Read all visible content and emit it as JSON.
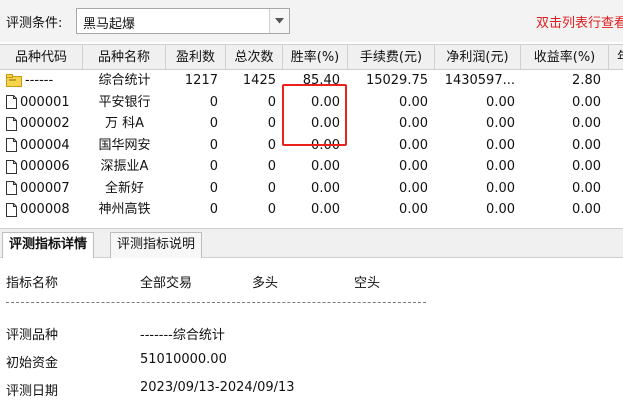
{
  "filter": {
    "label": "评测条件:",
    "value": "黑马起爆",
    "hint": "双击列表行查看"
  },
  "table": {
    "columns": [
      "品种代码",
      "品种名称",
      "盈利数",
      "总次数",
      "胜率(%)",
      "手续费(元)",
      "净利润(元)",
      "收益率(%)",
      "年"
    ],
    "rows": [
      {
        "code": "------",
        "name": "综合统计",
        "win": "1217",
        "total": "1425",
        "rate": "85.40",
        "fee": "15029.75",
        "profit": "1430597...",
        "ret": "2.80",
        "icon": "folder-icon"
      },
      {
        "code": "000001",
        "name": "平安银行",
        "win": "0",
        "total": "0",
        "rate": "0.00",
        "fee": "0.00",
        "profit": "0.00",
        "ret": "0.00",
        "icon": "document-icon"
      },
      {
        "code": "000002",
        "name": "万 科A",
        "win": "0",
        "total": "0",
        "rate": "0.00",
        "fee": "0.00",
        "profit": "0.00",
        "ret": "0.00",
        "icon": "document-icon"
      },
      {
        "code": "000004",
        "name": "国华网安",
        "win": "0",
        "total": "0",
        "rate": "0.00",
        "fee": "0.00",
        "profit": "0.00",
        "ret": "0.00",
        "icon": "document-icon"
      },
      {
        "code": "000006",
        "name": "深振业A",
        "win": "0",
        "total": "0",
        "rate": "0.00",
        "fee": "0.00",
        "profit": "0.00",
        "ret": "0.00",
        "icon": "document-icon"
      },
      {
        "code": "000007",
        "name": "全新好",
        "win": "0",
        "total": "0",
        "rate": "0.00",
        "fee": "0.00",
        "profit": "0.00",
        "ret": "0.00",
        "icon": "document-icon"
      },
      {
        "code": "000008",
        "name": "神州高铁",
        "win": "0",
        "total": "0",
        "rate": "0.00",
        "fee": "0.00",
        "profit": "0.00",
        "ret": "0.00",
        "icon": "document-icon"
      }
    ]
  },
  "tabs": [
    {
      "label": "评测指标详情",
      "active": true
    },
    {
      "label": "评测指标说明",
      "active": false
    }
  ],
  "details": {
    "header": [
      "指标名称",
      "全部交易",
      "多头",
      "空头"
    ],
    "separator": "--------------------------------------------------------------------------",
    "items": [
      {
        "label": "评测品种",
        "value": "-------综合统计"
      },
      {
        "label": "初始资金",
        "value": "51010000.00"
      },
      {
        "label": "评测日期",
        "value": "2023/09/13-2024/09/13"
      }
    ]
  },
  "colors": {
    "highlight": "#e8231c",
    "hint": "#e02020"
  }
}
